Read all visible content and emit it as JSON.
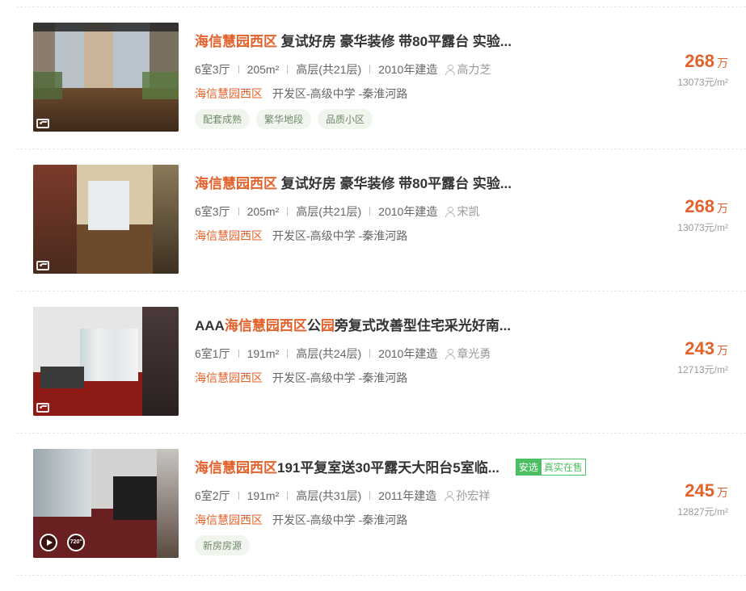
{
  "listings": [
    {
      "title_hl": "海信慧园西区",
      "title_rest": " 复试好房 豪华装修 带80平露台 实验...",
      "rooms": "6室3厅",
      "area": "205m²",
      "floor": "高层(共21层)",
      "built": "2010年建造",
      "agent": "高力芝",
      "community": "海信慧园西区",
      "location": "开发区-高级中学 -秦淮河路",
      "tags": [
        "配套成熟",
        "繁华地段",
        "品质小区"
      ],
      "price": "268",
      "price_unit": "万",
      "unit_price": "13073元/m²"
    },
    {
      "title_hl": "海信慧园西区",
      "title_rest": " 复试好房 豪华装修 带80平露台 实验...",
      "rooms": "6室3厅",
      "area": "205m²",
      "floor": "高层(共21层)",
      "built": "2010年建造",
      "agent": "宋凯",
      "community": "海信慧园西区",
      "location": "开发区-高级中学 -秦淮河路",
      "price": "268",
      "price_unit": "万",
      "unit_price": "13073元/m²"
    },
    {
      "title_pre": "AAA",
      "title_hl": "海信慧园西区",
      "title_mid": "公",
      "title_hl2": "园",
      "title_rest": "旁复式改善型住宅采光好南...",
      "rooms": "6室1厅",
      "area": "191m²",
      "floor": "高层(共24层)",
      "built": "2010年建造",
      "agent": "章光勇",
      "community": "海信慧园西区",
      "location": "开发区-高级中学 -秦淮河路",
      "price": "243",
      "price_unit": "万",
      "unit_price": "12713元/m²"
    },
    {
      "title_hl": "海信慧园西区",
      "title_rest": "191平复室送30平露天大阳台5室临...",
      "badge_primary": "安选",
      "badge_secondary": "真实在售",
      "rooms": "6室2厅",
      "area": "191m²",
      "floor": "高层(共31层)",
      "built": "2011年建造",
      "agent": "孙宏祥",
      "community": "海信慧园西区",
      "location": "开发区-高级中学 -秦淮河路",
      "tags": [
        "新房房源"
      ],
      "vr_label": "720°",
      "price": "245",
      "price_unit": "万",
      "unit_price": "12827元/m²"
    }
  ],
  "colors": {
    "accent": "#e4612a",
    "badge_green": "#4dbf63",
    "tag_bg": "#f0f5ee"
  }
}
